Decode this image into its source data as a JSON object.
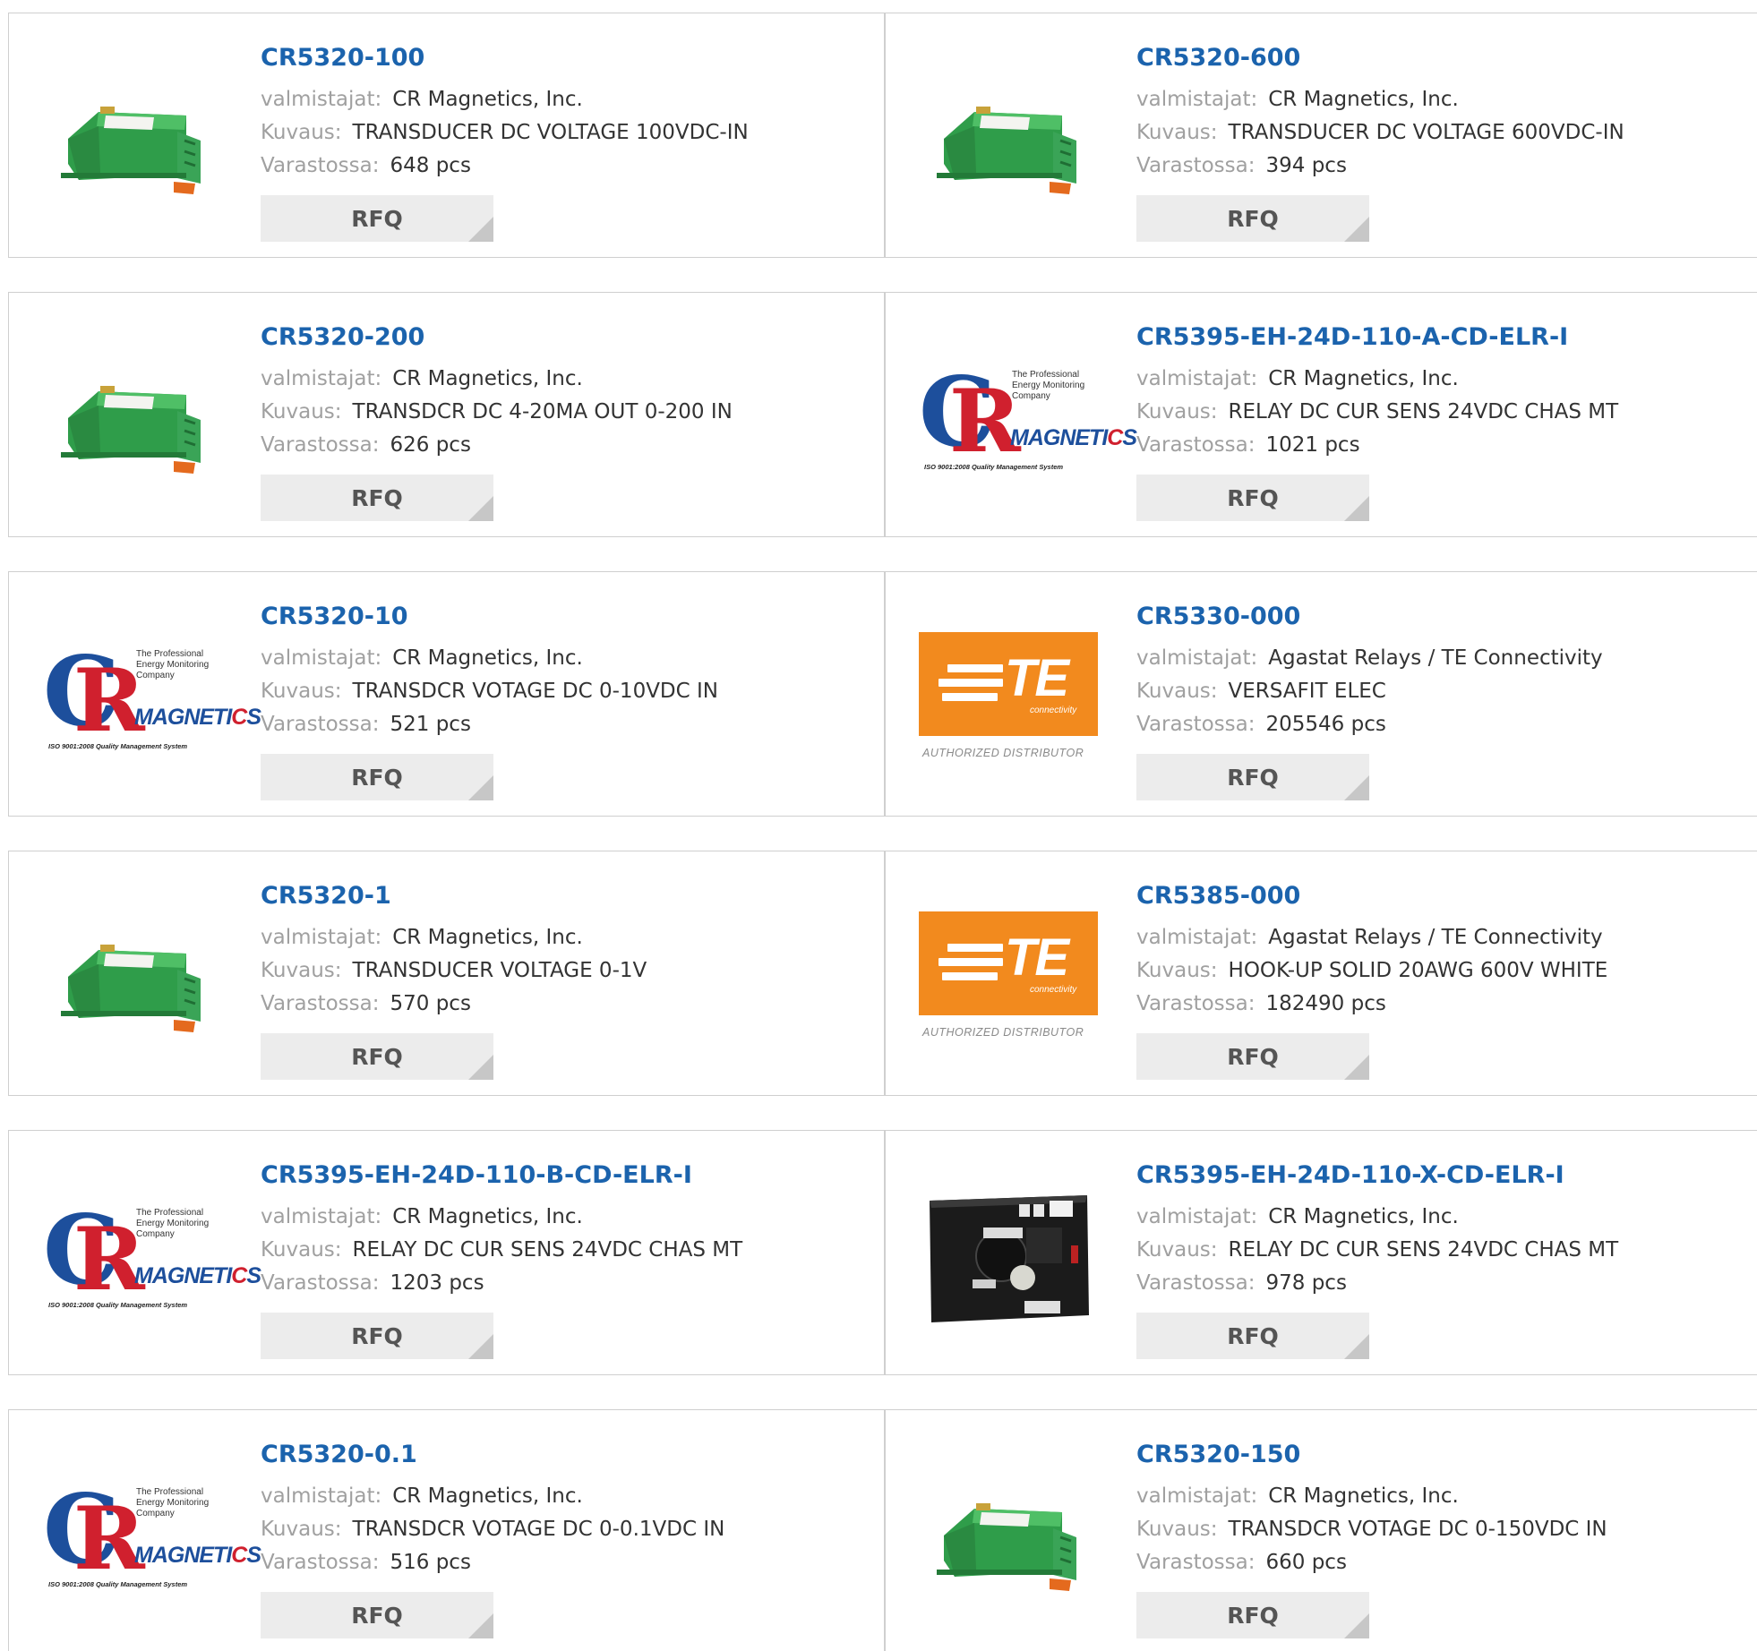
{
  "labels": {
    "manufacturer": "valmistajat:",
    "description": "Kuvaus:",
    "stock": "Varastossa:",
    "rfq": "RFQ"
  },
  "products": [
    {
      "part": "CR5320-100",
      "manufacturer": "CR Magnetics, Inc.",
      "description": "TRANSDUCER DC VOLTAGE 100VDC-IN",
      "stock": "648 pcs",
      "image": "green-transducer"
    },
    {
      "part": "CR5320-600",
      "manufacturer": "CR Magnetics, Inc.",
      "description": "TRANSDUCER DC VOLTAGE 600VDC-IN",
      "stock": "394 pcs",
      "image": "green-transducer"
    },
    {
      "part": "CR5320-200",
      "manufacturer": "CR Magnetics, Inc.",
      "description": "TRANSDCR DC 4-20MA OUT 0-200 IN",
      "stock": "626 pcs",
      "image": "green-transducer"
    },
    {
      "part": "CR5395-EH-24D-110-A-CD-ELR-I",
      "manufacturer": "CR Magnetics, Inc.",
      "description": "RELAY DC CUR SENS 24VDC CHAS MT",
      "stock": "1021 pcs",
      "image": "cr-logo"
    },
    {
      "part": "CR5320-10",
      "manufacturer": "CR Magnetics, Inc.",
      "description": "TRANSDCR VOTAGE DC 0-10VDC IN",
      "stock": "521 pcs",
      "image": "cr-logo"
    },
    {
      "part": "CR5330-000",
      "manufacturer": "Agastat Relays / TE Connectivity",
      "description": "VERSAFIT ELEC",
      "stock": "205546 pcs",
      "image": "te-logo"
    },
    {
      "part": "CR5320-1",
      "manufacturer": "CR Magnetics, Inc.",
      "description": "TRANSDUCER VOLTAGE 0-1V",
      "stock": "570 pcs",
      "image": "green-transducer"
    },
    {
      "part": "CR5385-000",
      "manufacturer": "Agastat Relays / TE Connectivity",
      "description": "HOOK-UP SOLID 20AWG 600V WHITE",
      "stock": "182490 pcs",
      "image": "te-logo"
    },
    {
      "part": "CR5395-EH-24D-110-B-CD-ELR-I",
      "manufacturer": "CR Magnetics, Inc.",
      "description": "RELAY DC CUR SENS 24VDC CHAS MT",
      "stock": "1203 pcs",
      "image": "cr-logo"
    },
    {
      "part": "CR5395-EH-24D-110-X-CD-ELR-I",
      "manufacturer": "CR Magnetics, Inc.",
      "description": "RELAY DC CUR SENS 24VDC CHAS MT",
      "stock": "978 pcs",
      "image": "black-relay"
    },
    {
      "part": "CR5320-0.1",
      "manufacturer": "CR Magnetics, Inc.",
      "description": "TRANSDCR VOTAGE DC 0-0.1VDC IN",
      "stock": "516 pcs",
      "image": "cr-logo"
    },
    {
      "part": "CR5320-150",
      "manufacturer": "CR Magnetics, Inc.",
      "description": "TRANSDCR VOTAGE DC 0-150VDC IN",
      "stock": "660 pcs",
      "image": "green-transducer"
    }
  ],
  "logo_text": {
    "cr_tagline": "The Professional Energy Monitoring Company",
    "cr_brand": "MAGNETICS",
    "cr_iso": "ISO 9001:2008 Quality Management System",
    "te_brand": "TE",
    "te_connectivity": "connectivity",
    "te_authorized": "AUTHORIZED DISTRIBUTOR"
  },
  "colors": {
    "title": "#1b63ad",
    "label": "#a0a0a0",
    "rfq_bg": "#ececec",
    "te_orange": "#f28a1e",
    "cr_blue": "#1d4f9c",
    "cr_red": "#d0202e"
  }
}
